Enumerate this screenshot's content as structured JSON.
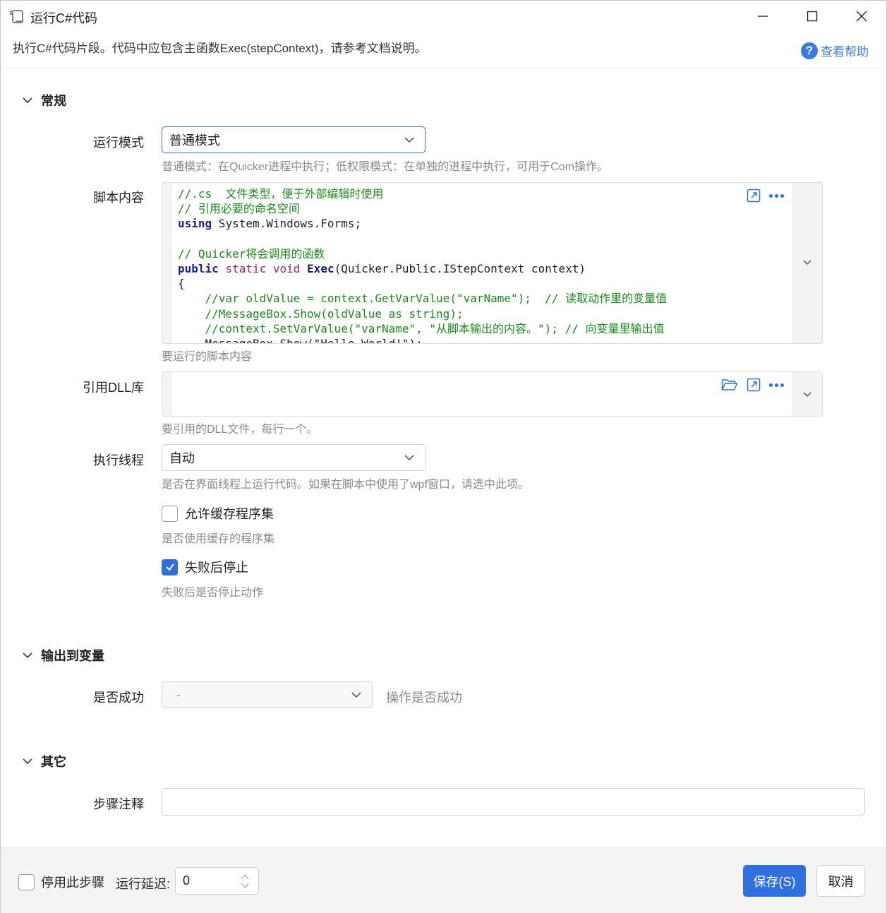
{
  "window": {
    "title": "运行C#代码",
    "description": "执行C#代码片段。代码中应包含主函数Exec(stepContext)，请参考文档说明。",
    "help_label": "查看帮助"
  },
  "sections": {
    "general": "常规",
    "output": "输出到变量",
    "other": "其它"
  },
  "run_mode": {
    "label": "运行模式",
    "value": "普通模式",
    "hint": "普通模式：在Quicker进程中执行；低权限模式：在单独的进程中执行，可用于Com操作。"
  },
  "script": {
    "label": "脚本内容",
    "hint": "要运行的脚本内容",
    "lines": [
      "//.cs  文件类型，便于外部编辑时使用",
      "// 引用必要的命名空间",
      "using System.Windows.Forms;",
      "",
      "// Quicker将会调用的函数",
      "public static void Exec(Quicker.Public.IStepContext context)",
      "{",
      "    //var oldValue = context.GetVarValue(\"varName\");  // 读取动作里的变量值",
      "    //MessageBox.Show(oldValue as string);",
      "    //context.SetVarValue(\"varName\", \"从脚本输出的内容。\"); // 向变量里输出值",
      "    MessageBox.Show(\"Hello World!\");"
    ]
  },
  "dll": {
    "label": "引用DLL库",
    "value": "",
    "hint": "要引用的DLL文件，每行一个。"
  },
  "thread": {
    "label": "执行线程",
    "value": "自动",
    "hint": "是否在界面线程上运行代码。如果在脚本中使用了wpf窗口，请选中此项。"
  },
  "cache": {
    "label": "允许缓存程序集",
    "checked": false,
    "hint": "是否使用缓存的程序集"
  },
  "stop_on_fail": {
    "label": "失败后停止",
    "checked": true,
    "hint": "失败后是否停止动作"
  },
  "success": {
    "label": "是否成功",
    "value": "-",
    "hint": "操作是否成功"
  },
  "note": {
    "label": "步骤注释",
    "value": ""
  },
  "footer": {
    "disable_label": "停用此步骤",
    "delay_label": "运行延迟:",
    "delay_value": "0",
    "save_label": "保存(S)",
    "cancel_label": "取消"
  },
  "colors": {
    "accent": "#2f6fe0",
    "comment": "#1b8a1b",
    "hint": "#8a8a8a"
  }
}
